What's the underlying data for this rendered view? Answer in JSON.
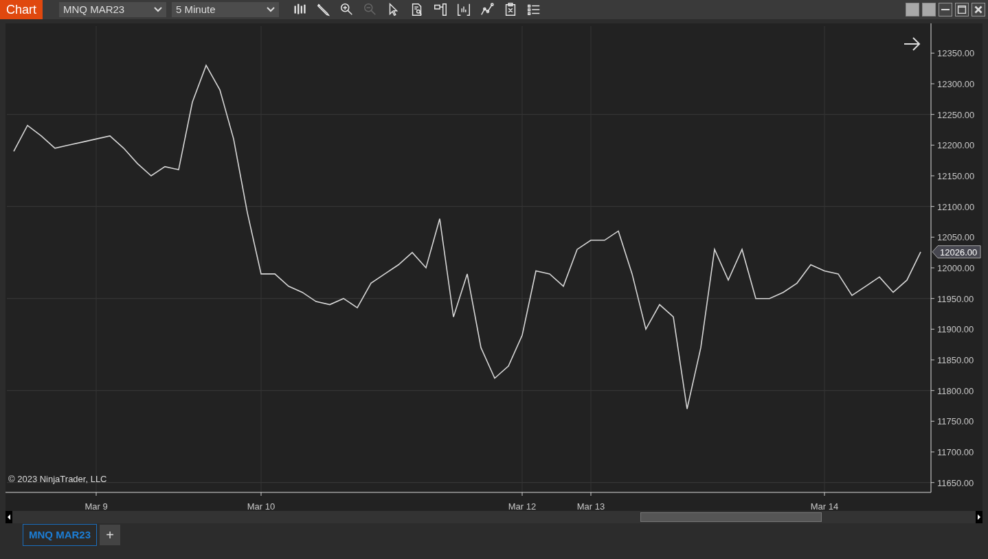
{
  "window": {
    "title": "Chart"
  },
  "toolbar": {
    "instrument": "MNQ MAR23",
    "interval": "5 Minute",
    "tools": [
      {
        "kind": "bars",
        "disabled": false
      },
      {
        "kind": "pencil",
        "disabled": false
      },
      {
        "kind": "zoom-in",
        "disabled": false
      },
      {
        "kind": "zoom-out",
        "disabled": true
      },
      {
        "kind": "pointer",
        "disabled": false
      },
      {
        "kind": "document",
        "disabled": false
      },
      {
        "kind": "panel",
        "disabled": false
      },
      {
        "kind": "chart",
        "disabled": false
      },
      {
        "kind": "line",
        "disabled": false
      },
      {
        "kind": "clipboard",
        "disabled": false
      },
      {
        "kind": "list",
        "disabled": false
      }
    ]
  },
  "chart": {
    "copyright": "© 2023 NinjaTrader, LLC",
    "last_price": "12026.00",
    "chart_data": {
      "type": "line",
      "grid": true,
      "ylim": [
        11634,
        12394
      ],
      "categories": [
        null,
        null,
        null,
        null,
        null,
        null,
        "Mar 9",
        null,
        null,
        null,
        null,
        null,
        null,
        null,
        null,
        null,
        null,
        null,
        "Mar 10",
        null,
        null,
        null,
        null,
        null,
        null,
        null,
        null,
        null,
        null,
        null,
        null,
        null,
        null,
        null,
        null,
        null,
        null,
        "Mar 12",
        null,
        null,
        null,
        null,
        "Mar 13",
        null,
        null,
        null,
        null,
        null,
        null,
        null,
        null,
        null,
        null,
        null,
        null,
        null,
        null,
        null,
        null,
        "Mar 14",
        null,
        null,
        null,
        null,
        null,
        null,
        null
      ],
      "yticks": [
        {
          "value": 12350,
          "label": "12350.00"
        },
        {
          "value": 12300,
          "label": "12300.00"
        },
        {
          "value": 12250,
          "label": "12250.00"
        },
        {
          "value": 12200,
          "label": "12200.00"
        },
        {
          "value": 12150,
          "label": "12150.00"
        },
        {
          "value": 12100,
          "label": "12100.00"
        },
        {
          "value": 12050,
          "label": "12050.00"
        },
        {
          "value": 12000,
          "label": "12000.00"
        },
        {
          "value": 11950,
          "label": "11950.00"
        },
        {
          "value": 11900,
          "label": "11900.00"
        },
        {
          "value": 11850,
          "label": "11850.00"
        },
        {
          "value": 11800,
          "label": "11800.00"
        },
        {
          "value": 11750,
          "label": "11750.00"
        },
        {
          "value": 11700,
          "label": "11700.00"
        },
        {
          "value": 11650,
          "label": "11650.00"
        }
      ],
      "series": [
        {
          "color": "#d8d8d8",
          "values": [
            12190,
            12232,
            12215,
            12195,
            12200,
            12205,
            12210,
            12215,
            12195,
            12170,
            12150,
            12165,
            12160,
            12270,
            12330,
            12290,
            12210,
            12090,
            11990,
            11990,
            11970,
            11960,
            11945,
            11940,
            11950,
            11935,
            11975,
            11990,
            12005,
            12025,
            12000,
            12080,
            11920,
            11990,
            11870,
            11820,
            11840,
            11890,
            11995,
            11990,
            11970,
            12030,
            12045,
            12045,
            12060,
            11990,
            11900,
            11940,
            11920,
            11770,
            11870,
            12030,
            11980,
            12030,
            11950,
            11950,
            11960,
            11975,
            12005,
            11995,
            11990,
            11955,
            11970,
            11985,
            11960,
            11980,
            12026
          ]
        }
      ]
    }
  },
  "tabs": [
    {
      "label": "MNQ MAR23",
      "selected": true
    }
  ],
  "add_tab": "+"
}
